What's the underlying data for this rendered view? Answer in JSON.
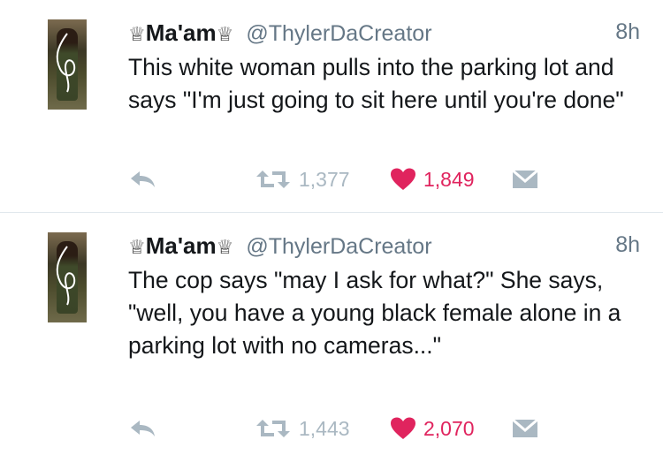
{
  "tweets": [
    {
      "display_name": "Ma'am",
      "crown_glyph": "♕",
      "handle": "@ThylerDaCreator",
      "time": "8h",
      "text": "This white woman pulls into the parking lot and says \"I'm just going to sit here until you're done\"",
      "retweets": "1,377",
      "likes": "1,849"
    },
    {
      "display_name": "Ma'am",
      "crown_glyph": "♕",
      "handle": "@ThylerDaCreator",
      "time": "8h",
      "text": "The cop says \"may I ask for what?\" She says, \"well, you have a young black female alone in a parking lot with no cameras...\"",
      "retweets": "1,443",
      "likes": "2,070"
    }
  ],
  "colors": {
    "icon_gray": "#aab8c2",
    "like_red": "#e0245e",
    "text": "#14171a",
    "secondary": "#657786",
    "divider": "#e1e8ed"
  },
  "icons": [
    "reply-icon",
    "retweet-icon",
    "heart-icon",
    "direct-message-icon"
  ]
}
